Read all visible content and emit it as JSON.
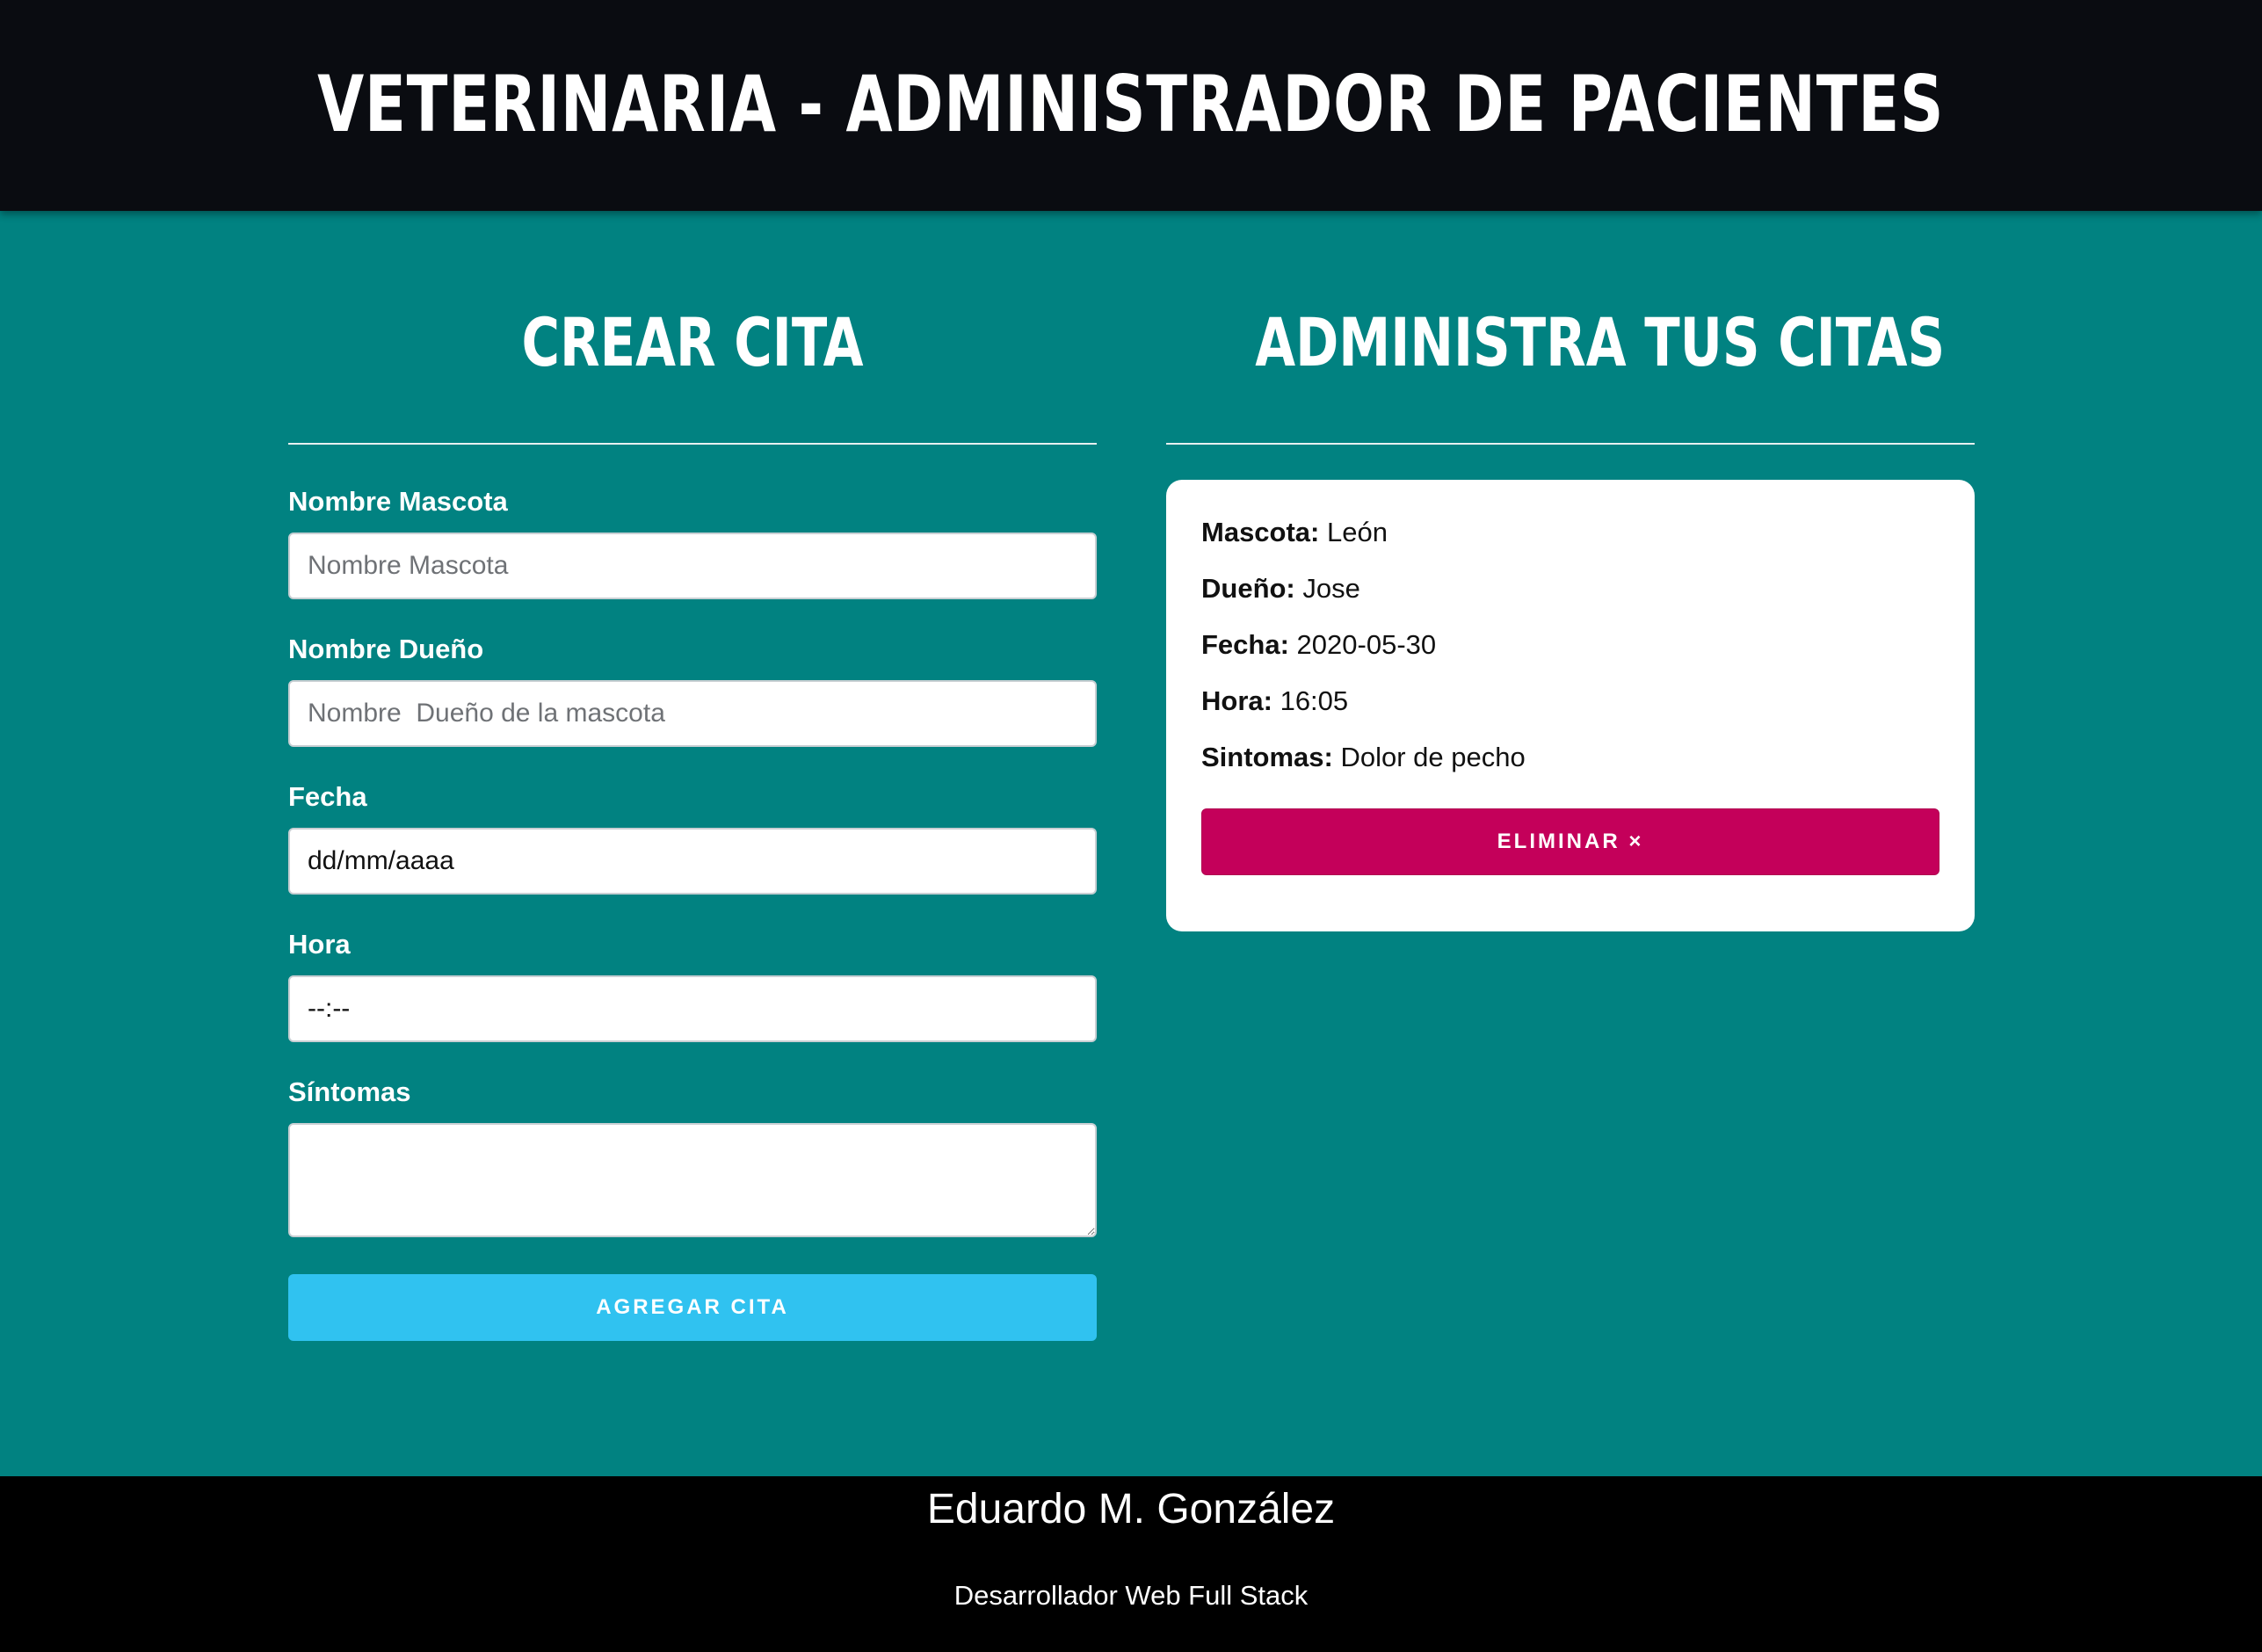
{
  "header": {
    "title": "Veterinaria - Administrador de Pacientes"
  },
  "form_section": {
    "title": "Crear Cita",
    "fields": [
      {
        "label": "Nombre Mascota",
        "placeholder": "Nombre Mascota",
        "value": ""
      },
      {
        "label": "Nombre Dueño",
        "placeholder": "Nombre  Dueño de la mascota",
        "value": ""
      },
      {
        "label": "Fecha",
        "display": "dd/mm/aaaa"
      },
      {
        "label": "Hora",
        "display": "--:--"
      },
      {
        "label": "Síntomas",
        "value": ""
      }
    ],
    "submit_label": "Agregar Cita"
  },
  "appointments_section": {
    "title": "Administra tus citas",
    "appointments": [
      {
        "pet_label": "Mascota:",
        "pet": "León",
        "owner_label": "Dueño:",
        "owner": "Jose",
        "date_label": "Fecha:",
        "date": "2020-05-30",
        "time_label": "Hora:",
        "time": "16:05",
        "symptoms_label": "Sintomas:",
        "symptoms": "Dolor de pecho",
        "delete_label": "Eliminar ×"
      }
    ]
  },
  "footer": {
    "name": "Eduardo M. González",
    "role": "Desarrollador Web Full Stack"
  },
  "colors": {
    "header_bg": "#0a0c11",
    "page_bg": "#018281",
    "submit_bg": "#30c2f0",
    "delete_bg": "#c4005a",
    "footer_bg": "#000000"
  }
}
